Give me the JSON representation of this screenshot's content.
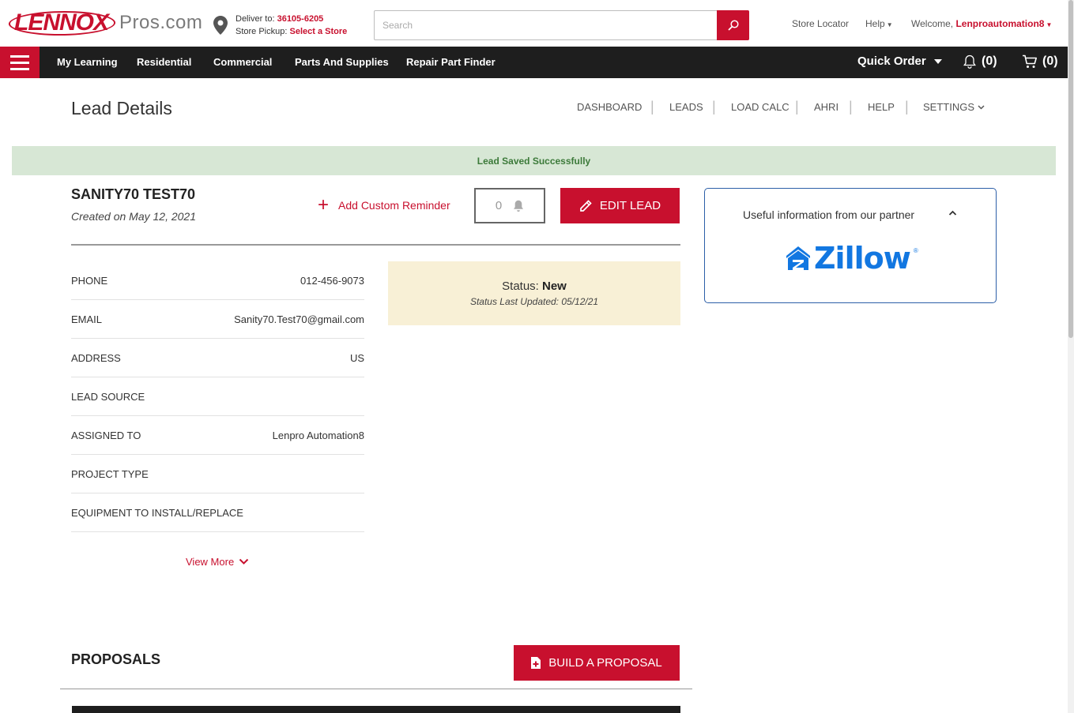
{
  "header": {
    "logo_brand": "LENNOX",
    "logo_site": "Pros.com",
    "deliver_label": "Deliver to: ",
    "deliver_zip": "36105-6205",
    "pickup_label": "Store Pickup: ",
    "pickup_value": "Select a Store",
    "search_placeholder": "Search",
    "store_locator": "Store Locator",
    "help": "Help",
    "welcome_label": "Welcome, ",
    "username": "Lenproautomation8"
  },
  "nav": {
    "items": [
      "My Learning",
      "Residential",
      "Commercial",
      "Parts And Supplies",
      "Repair Part Finder"
    ],
    "quick_order": "Quick Order",
    "notifications_count": "(0)",
    "cart_count": "(0)"
  },
  "page": {
    "title": "Lead Details",
    "subnav": [
      "DASHBOARD",
      "LEADS",
      "LOAD CALC",
      "AHRI",
      "HELP",
      "SETTINGS"
    ]
  },
  "success_message": "Lead Saved Successfully",
  "lead": {
    "name": "SANITY70 TEST70",
    "created": "Created on May 12, 2021",
    "add_reminder": "Add Custom Reminder",
    "reminder_count": "0",
    "edit_label": "EDIT LEAD",
    "fields": [
      {
        "label": "PHONE",
        "value": "012-456-9073"
      },
      {
        "label": "EMAIL",
        "value": "Sanity70.Test70@gmail.com"
      },
      {
        "label": "ADDRESS",
        "value": "US"
      },
      {
        "label": "LEAD SOURCE",
        "value": ""
      },
      {
        "label": "ASSIGNED TO",
        "value": "Lenpro Automation8"
      },
      {
        "label": "PROJECT TYPE",
        "value": ""
      },
      {
        "label": "EQUIPMENT TO INSTALL/REPLACE",
        "value": ""
      }
    ],
    "status_label": "Status: ",
    "status_value": "New",
    "status_updated": "Status Last Updated: 05/12/21",
    "view_more": "View More"
  },
  "partner": {
    "title": "Useful information from our partner",
    "logo_text": "Zillow",
    "logo_reg": "®"
  },
  "proposals": {
    "title": "PROPOSALS",
    "build_label": "BUILD A PROPOSAL"
  },
  "colors": {
    "brand_red": "#c8102e",
    "nav_dark": "#1e1e1e",
    "success_bg": "#d7e7d5",
    "status_bg": "#f8f0d6",
    "zillow_blue": "#1277e1"
  }
}
